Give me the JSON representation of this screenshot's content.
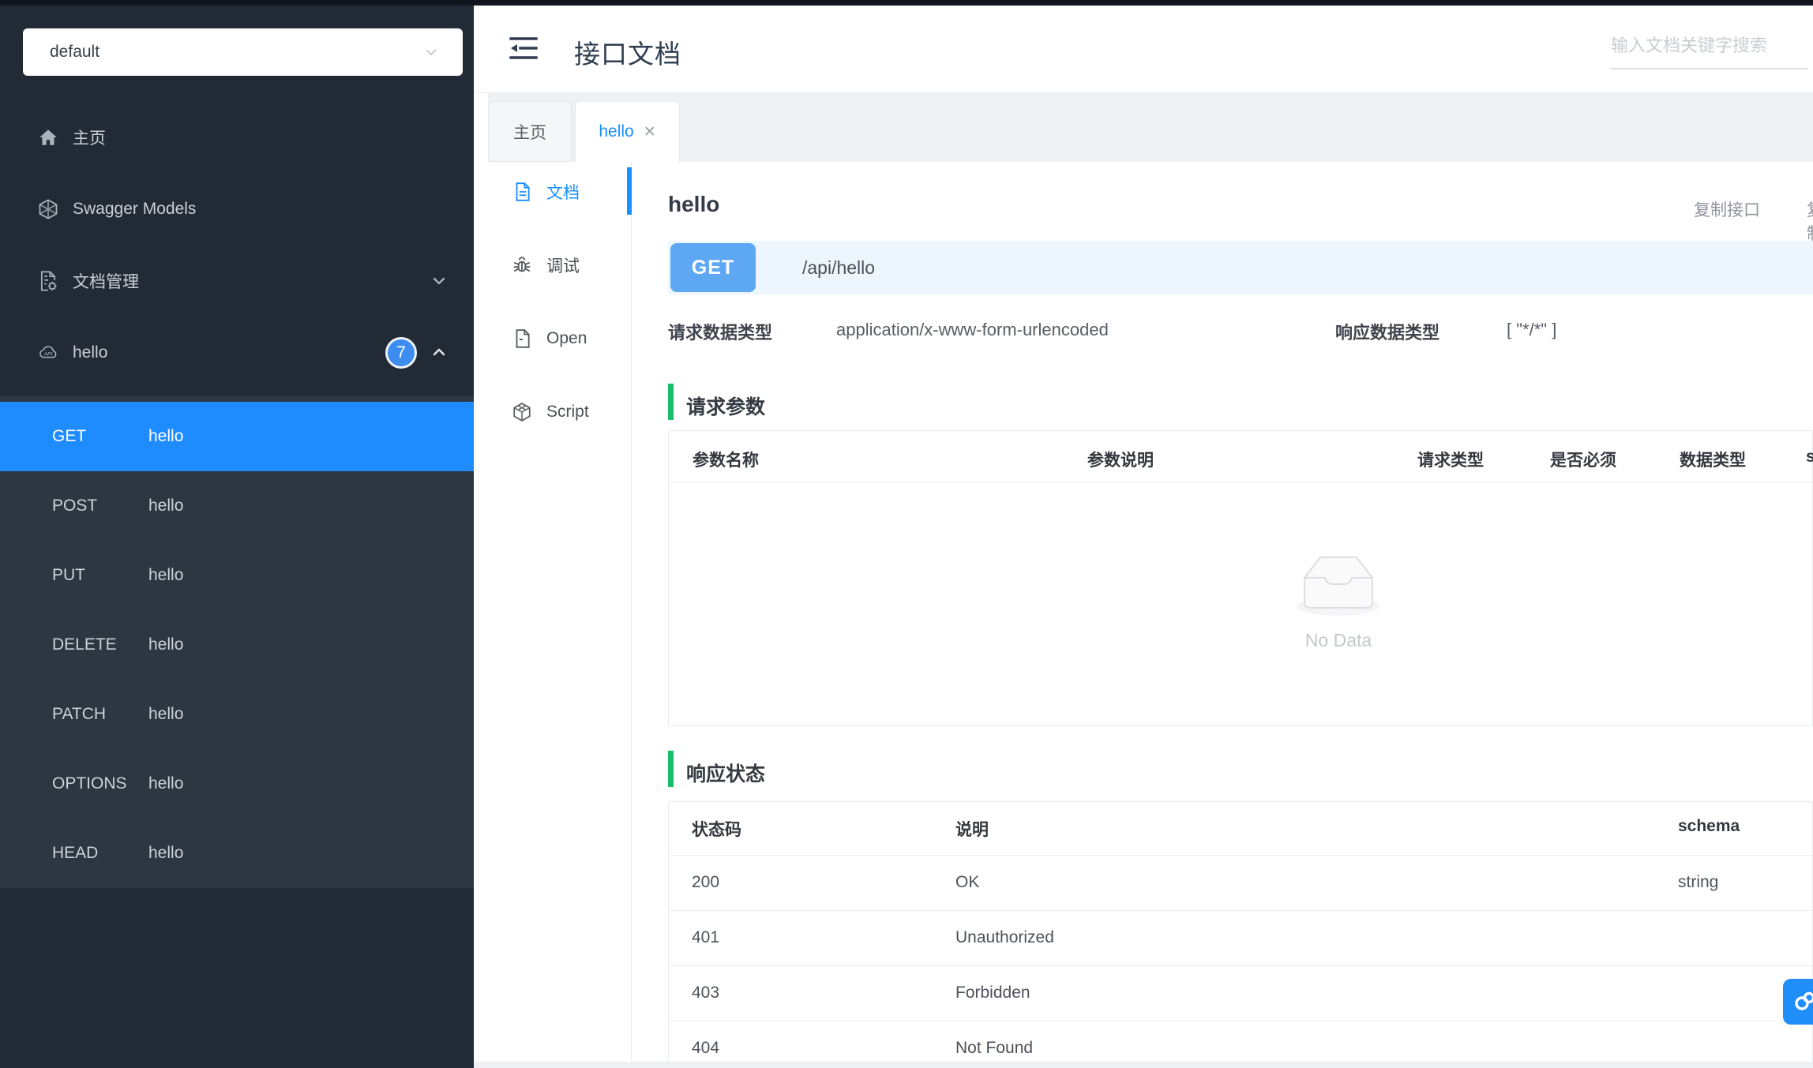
{
  "colors": {
    "accent": "#1890ff",
    "sidebar_active": "#1e8cff",
    "get_badge": "#5ea7f2",
    "section_green": "#19be6b"
  },
  "sidebar": {
    "group_select": {
      "value": "default"
    },
    "items": [
      {
        "label": "主页"
      },
      {
        "label": "Swagger Models"
      },
      {
        "label": "文档管理"
      },
      {
        "label": "hello",
        "badge": "7"
      }
    ],
    "methods": [
      {
        "verb": "GET",
        "name": "hello"
      },
      {
        "verb": "POST",
        "name": "hello"
      },
      {
        "verb": "PUT",
        "name": "hello"
      },
      {
        "verb": "DELETE",
        "name": "hello"
      },
      {
        "verb": "PATCH",
        "name": "hello"
      },
      {
        "verb": "OPTIONS",
        "name": "hello"
      },
      {
        "verb": "HEAD",
        "name": "hello"
      }
    ]
  },
  "header": {
    "title": "接口文档",
    "search_placeholder": "输入文档关键字搜索"
  },
  "tabs": [
    {
      "label": "主页"
    },
    {
      "label": "hello",
      "close_glyph": "✕"
    }
  ],
  "rail": {
    "items": [
      {
        "label": "文档"
      },
      {
        "label": "调试"
      },
      {
        "label": "Open"
      },
      {
        "label": "Script"
      }
    ]
  },
  "doc": {
    "title": "hello",
    "copy_api_label": "复制接口",
    "copy_addr_label": "复制地址",
    "method": "GET",
    "path": "/api/hello",
    "request_type_label": "请求数据类型",
    "request_type_value": "application/x-www-form-urlencoded",
    "response_type_label": "响应数据类型",
    "response_type_value": "[ \"*/*\" ]",
    "params_section_title": "请求参数",
    "params_headers": [
      "参数名称",
      "参数说明",
      "请求类型",
      "是否必须",
      "数据类型",
      "schema"
    ],
    "empty_text": "No Data",
    "status_section_title": "响应状态",
    "status_headers": [
      "状态码",
      "说明",
      "schema"
    ],
    "status_rows": [
      {
        "code": "200",
        "desc": "OK",
        "schema": "string"
      },
      {
        "code": "401",
        "desc": "Unauthorized",
        "schema": ""
      },
      {
        "code": "403",
        "desc": "Forbidden",
        "schema": ""
      },
      {
        "code": "404",
        "desc": "Not Found",
        "schema": ""
      }
    ]
  }
}
